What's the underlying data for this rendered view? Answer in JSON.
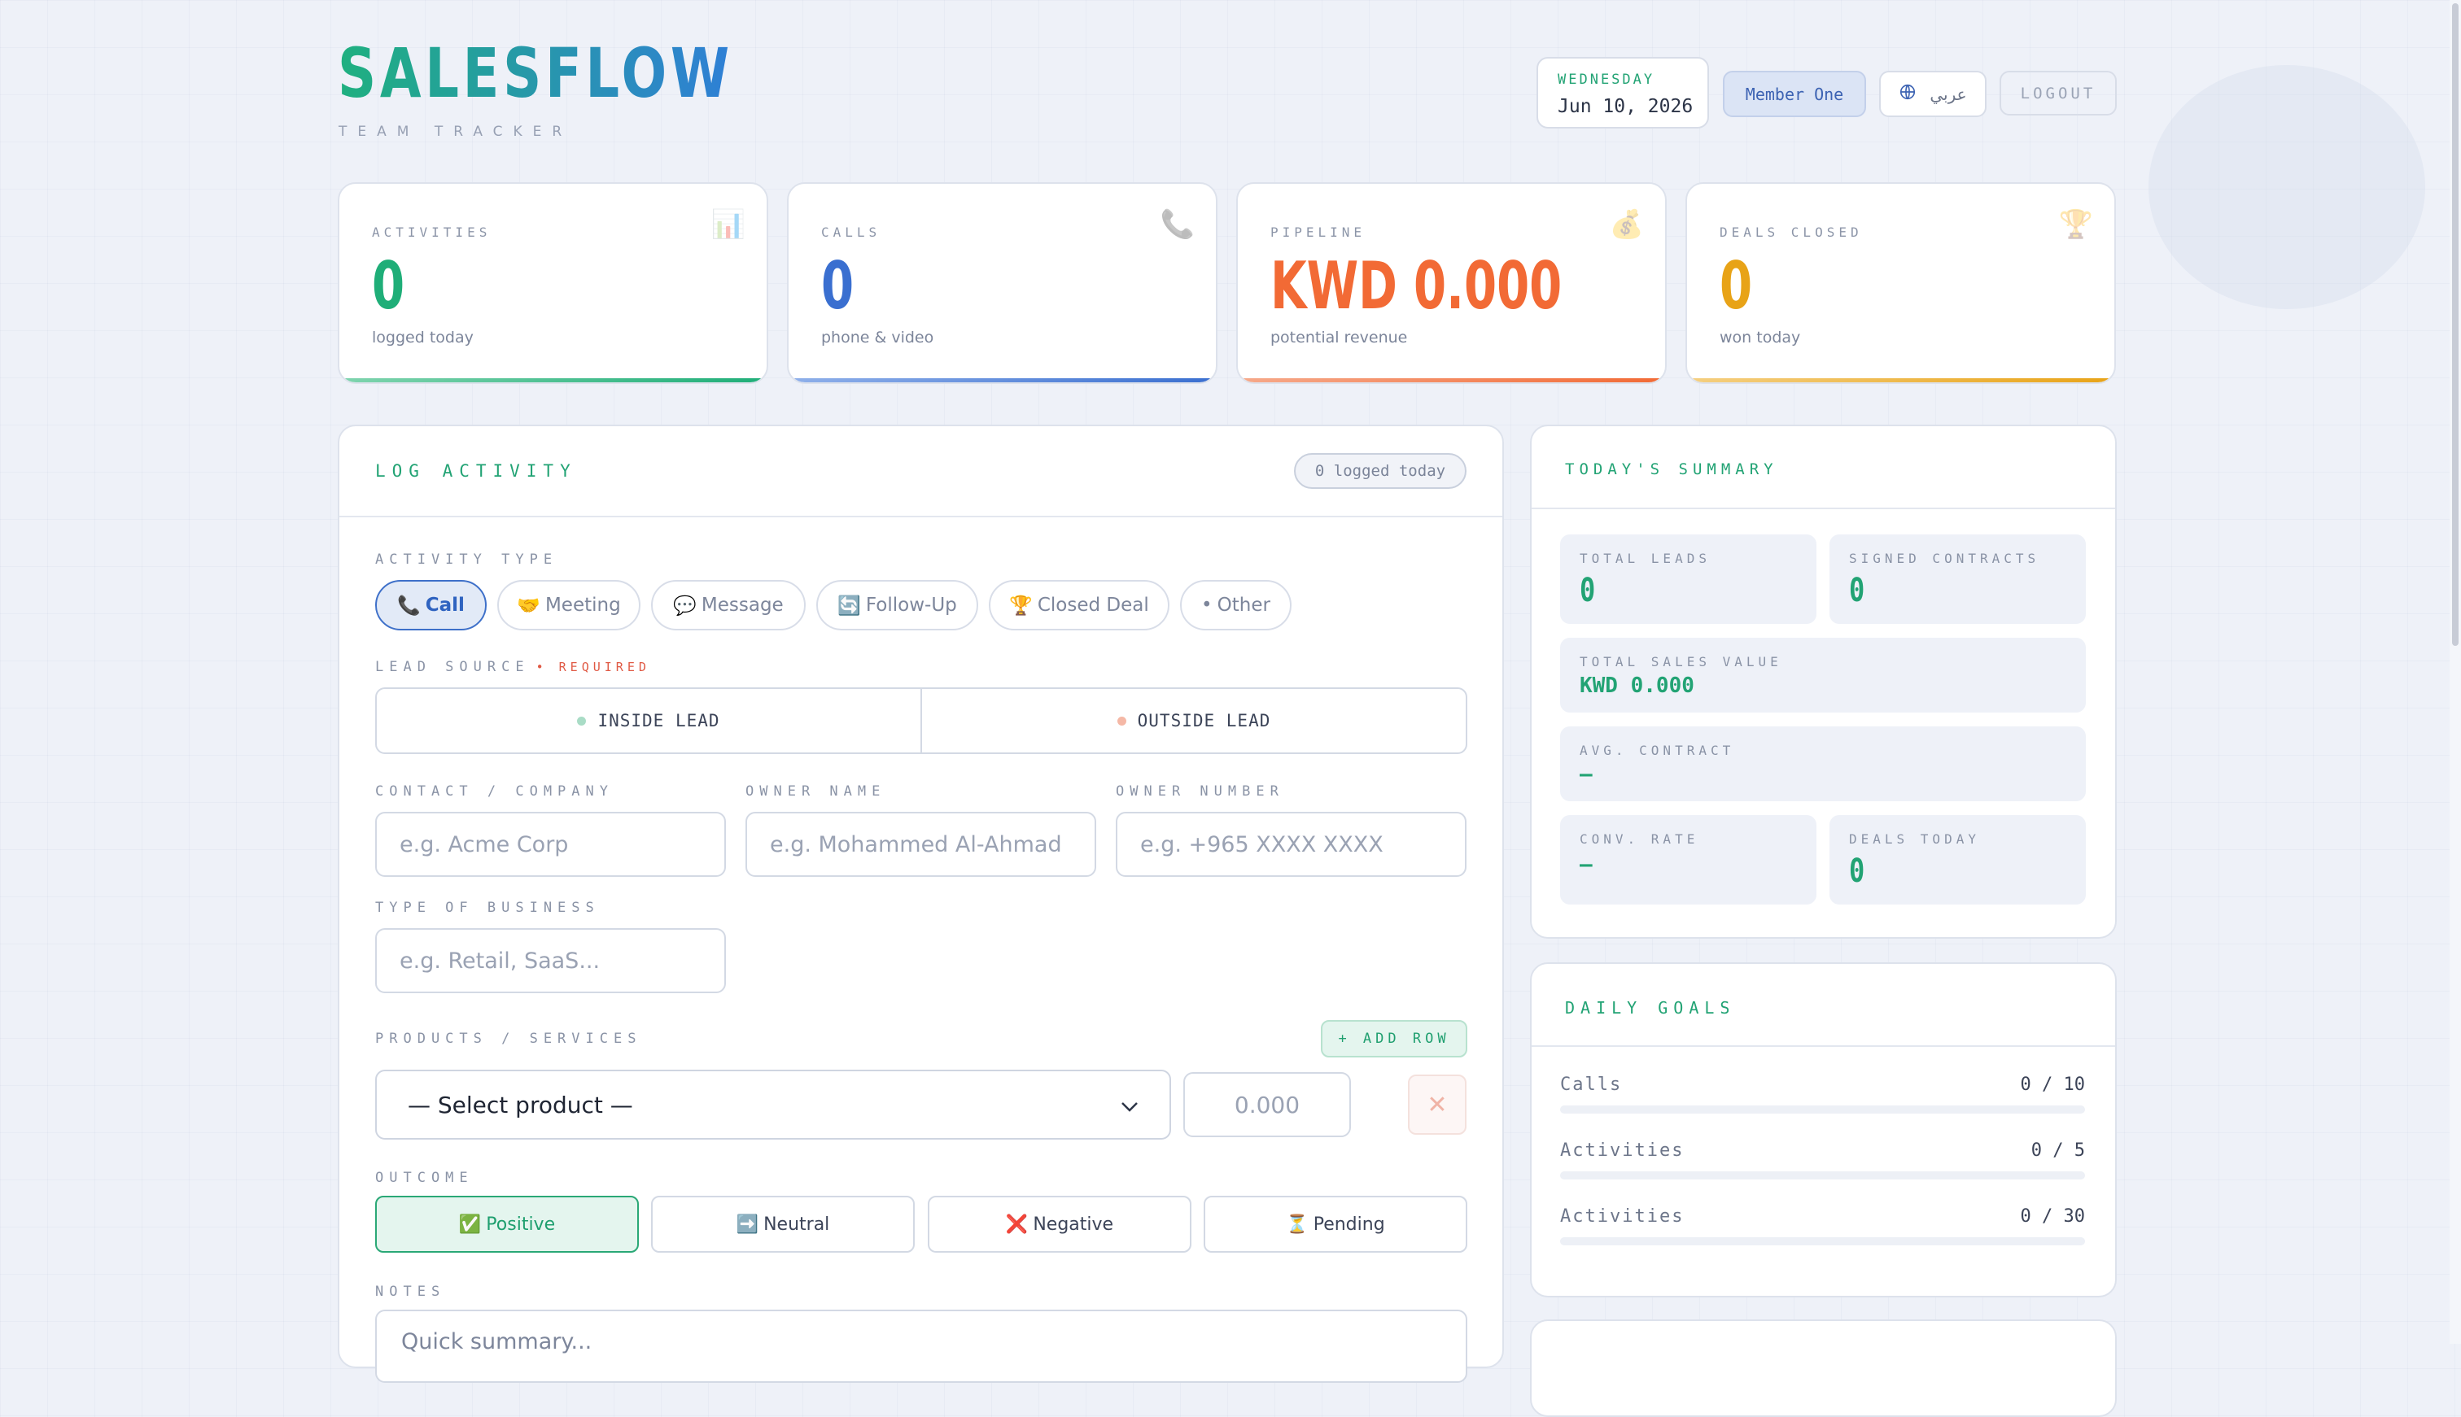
{
  "header": {
    "logo": "SALESFLOW",
    "tagline": "TEAM TRACKER",
    "day": "WEDNESDAY",
    "date": "Jun 10, 2026",
    "member": "Member One",
    "language": "عربي",
    "logout": "LOGOUT"
  },
  "stats": [
    {
      "label": "ACTIVITIES",
      "value": "0",
      "sub": "logged today",
      "icon": "bar-chart-icon",
      "color": "#1fae78",
      "glyph": "📊"
    },
    {
      "label": "CALLS",
      "value": "0",
      "sub": "phone & video",
      "icon": "phone-icon",
      "color": "#3a6fd0",
      "glyph": "📞"
    },
    {
      "label": "PIPELINE",
      "value": "KWD 0.000",
      "sub": "potential revenue",
      "icon": "money-bag-icon",
      "color": "#f26a35",
      "glyph": "💰"
    },
    {
      "label": "DEALS CLOSED",
      "value": "0",
      "sub": "won today",
      "icon": "trophy-icon",
      "color": "#e8a317",
      "glyph": "🏆"
    }
  ],
  "log": {
    "title": "LOG ACTIVITY",
    "badge": "0 logged today",
    "activity_type_label": "ACTIVITY TYPE",
    "activity_types": [
      {
        "label": "Call",
        "icon": "📞"
      },
      {
        "label": "Meeting",
        "icon": "🤝"
      },
      {
        "label": "Message",
        "icon": "💬"
      },
      {
        "label": "Follow-Up",
        "icon": "🔄"
      },
      {
        "label": "Closed Deal",
        "icon": "🏆"
      },
      {
        "label": "Other",
        "icon": "•"
      }
    ],
    "selected_activity": "Call",
    "lead_source_label": "LEAD SOURCE",
    "required": "• REQUIRED",
    "inside_lead": "INSIDE LEAD",
    "outside_lead": "OUTSIDE LEAD",
    "contact_label": "CONTACT / COMPANY",
    "contact_placeholder": "e.g. Acme Corp",
    "owner_name_label": "OWNER NAME",
    "owner_name_placeholder": "e.g. Mohammed Al-Ahmad",
    "owner_number_label": "OWNER NUMBER",
    "owner_number_placeholder": "e.g. +965 XXXX XXXX",
    "business_type_label": "TYPE OF BUSINESS",
    "business_type_placeholder": "e.g. Retail, SaaS...",
    "products_label": "PRODUCTS / SERVICES",
    "add_row": "+ ADD ROW",
    "product_select": "— Select product —",
    "amount": "0.000",
    "outcome_label": "OUTCOME",
    "outcomes": [
      {
        "label": "Positive",
        "icon": "✅"
      },
      {
        "label": "Neutral",
        "icon": "➡️"
      },
      {
        "label": "Negative",
        "icon": "❌"
      },
      {
        "label": "Pending",
        "icon": "⏳"
      }
    ],
    "selected_outcome": "Positive",
    "notes_label": "NOTES",
    "notes_placeholder": "Quick summary..."
  },
  "summary": {
    "title": "TODAY'S SUMMARY",
    "total_leads_label": "TOTAL LEADS",
    "total_leads": "0",
    "signed_contracts_label": "SIGNED CONTRACTS",
    "signed_contracts": "0",
    "total_sales_label": "TOTAL SALES VALUE",
    "total_sales": "KWD 0.000",
    "avg_contract_label": "AVG. CONTRACT",
    "avg_contract": "—",
    "conv_rate_label": "CONV. RATE",
    "conv_rate": "—",
    "deals_today_label": "DEALS TODAY",
    "deals_today": "0"
  },
  "goals": {
    "title": "DAILY GOALS",
    "items": [
      {
        "label": "Calls",
        "value": "0 / 10",
        "progress": 0
      },
      {
        "label": "Activities",
        "value": "0 / 5",
        "progress": 0
      },
      {
        "label": "Activities",
        "value": "0 / 30",
        "progress": 0
      }
    ]
  }
}
